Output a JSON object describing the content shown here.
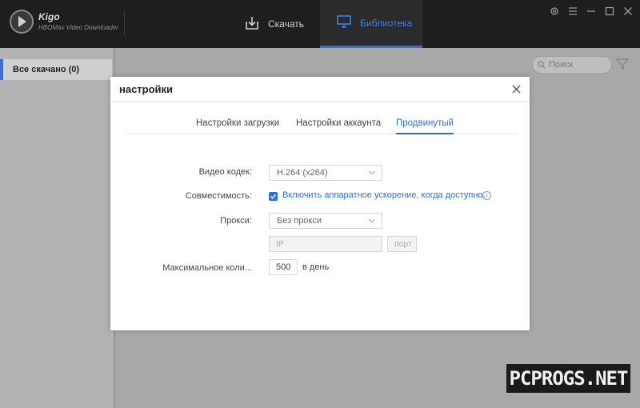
{
  "app": {
    "name": "Kigo",
    "subtitle": "HBOMax Video Downloader"
  },
  "nav": {
    "download_label": "Скачать",
    "library_label": "Библиотека"
  },
  "sidebar": {
    "items": [
      {
        "label": "Все скачано (0)"
      }
    ]
  },
  "search": {
    "placeholder": "Поиск"
  },
  "watermark": "PCPROGS.NET",
  "dialog": {
    "title": "настройки",
    "tabs": [
      {
        "label": "Настройки загрузки",
        "active": false
      },
      {
        "label": "Настройки аккаунта",
        "active": false
      },
      {
        "label": "Продвинутый",
        "active": true
      }
    ],
    "video_codec": {
      "label": "Видео кодек:",
      "value": "H.264 (x264)"
    },
    "compatibility": {
      "label": "Совместимость:",
      "checkbox_label": "Включить аппаратное ускорение, когда доступно.",
      "checked": true
    },
    "proxy": {
      "label": "Прокси:",
      "value": "Без прокси",
      "ip_placeholder": "IP",
      "port_placeholder": "порт"
    },
    "max": {
      "label": "Максимальное коли...",
      "value": "500",
      "suffix": "в день"
    }
  },
  "colors": {
    "accent": "#2f6fd8",
    "titlebar": "#1e1e1e"
  }
}
